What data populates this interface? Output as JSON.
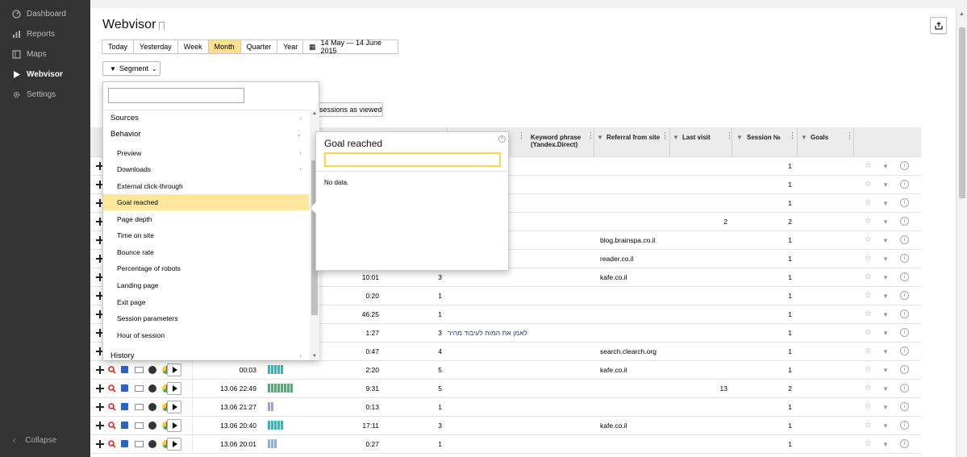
{
  "sidebar": {
    "items": [
      {
        "label": "Dashboard",
        "icon": "dashboard-icon"
      },
      {
        "label": "Reports",
        "icon": "reports-icon"
      },
      {
        "label": "Maps",
        "icon": "maps-icon"
      },
      {
        "label": "Webvisor",
        "icon": "play-icon",
        "active": true
      },
      {
        "label": "Settings",
        "icon": "gear-icon"
      }
    ],
    "collapse_label": "Collapse"
  },
  "header": {
    "title": "Webvisor"
  },
  "periods": [
    "Today",
    "Yesterday",
    "Week",
    "Month",
    "Quarter",
    "Year"
  ],
  "active_period": "Month",
  "date_range": "14 May — 14 June 2015",
  "segment_label": "Segment",
  "viewed_button": "sessions as viewed",
  "table": {
    "headers": {
      "keyword": "Keyword phrase (Yandex.Direct)",
      "referral": "Referral from site",
      "last_visit": "Last visit",
      "session_no": "Session №",
      "goals": "Goals"
    },
    "rows": [
      {
        "time": "",
        "duration": "",
        "depth": "",
        "keyword": "",
        "referral": "",
        "last_visit": "",
        "session": "1"
      },
      {
        "time": "",
        "duration": "",
        "depth": "",
        "keyword": "",
        "referral": "",
        "last_visit": "",
        "session": "1"
      },
      {
        "time": "",
        "duration": "",
        "depth": "",
        "keyword": "",
        "referral": "",
        "last_visit": "",
        "session": "1"
      },
      {
        "time": "",
        "duration": "",
        "depth": "",
        "keyword": "",
        "referral": "",
        "last_visit": "2",
        "session": "2"
      },
      {
        "time": "",
        "duration": "",
        "depth": "",
        "keyword": "",
        "referral": "blog.brainspa.co.il",
        "last_visit": "",
        "session": "1"
      },
      {
        "time": "",
        "duration": "",
        "depth": "",
        "keyword": "",
        "referral": "reader.co.il",
        "last_visit": "",
        "session": "1"
      },
      {
        "time": "",
        "duration": "10:01",
        "depth": "3",
        "keyword": "",
        "referral": "kafe.co.il",
        "last_visit": "",
        "session": "1"
      },
      {
        "time": "",
        "duration": "0:20",
        "depth": "1",
        "keyword": "",
        "referral": "",
        "last_visit": "",
        "session": "1"
      },
      {
        "time": "",
        "duration": "46:25",
        "depth": "1",
        "keyword": "",
        "referral": "",
        "last_visit": "",
        "session": "1"
      },
      {
        "time": "",
        "duration": "1:27",
        "depth": "3",
        "keyword": "לאמן את המוח לעיבוד מהיר",
        "referral": "",
        "last_visit": "",
        "session": "1"
      },
      {
        "time": "",
        "duration": "0:47",
        "depth": "4",
        "keyword": "",
        "referral": "search.clearch.org",
        "last_visit": "",
        "session": "1"
      },
      {
        "time": "00:03",
        "duration": "2:20",
        "depth": "5",
        "keyword": "",
        "referral": "kafe.co.il",
        "last_visit": "",
        "session": "1",
        "bars": "teal5"
      },
      {
        "time": "13.06 22:49",
        "duration": "9:31",
        "depth": "5",
        "keyword": "",
        "referral": "",
        "last_visit": "13",
        "session": "2",
        "bars": "green8"
      },
      {
        "time": "13.06 21:27",
        "duration": "0:13",
        "depth": "1",
        "keyword": "",
        "referral": "",
        "last_visit": "",
        "session": "1",
        "bars": "purple2"
      },
      {
        "time": "13.06 20:40",
        "duration": "17:11",
        "depth": "3",
        "keyword": "",
        "referral": "kafe.co.il",
        "last_visit": "",
        "session": "1",
        "bars": "teal5"
      },
      {
        "time": "13.06 20:01",
        "duration": "0:27",
        "depth": "1",
        "keyword": "",
        "referral": "",
        "last_visit": "",
        "session": "1",
        "bars": "blue3"
      }
    ]
  },
  "segment_menu": {
    "items": [
      {
        "label": "Sources",
        "type": "cat",
        "arrow": "›"
      },
      {
        "label": "Behavior",
        "type": "cat",
        "arrow": "⌄"
      },
      {
        "label": "Preview",
        "type": "sub",
        "arrow": "›"
      },
      {
        "label": "Downloads",
        "type": "sub",
        "arrow": "›"
      },
      {
        "label": "External click-through",
        "type": "sub"
      },
      {
        "label": "Goal reached",
        "type": "sub",
        "selected": true
      },
      {
        "label": "Page depth",
        "type": "sub"
      },
      {
        "label": "Time on site",
        "type": "sub"
      },
      {
        "label": "Bounce rate",
        "type": "sub"
      },
      {
        "label": "Percentage of robots",
        "type": "sub"
      },
      {
        "label": "Landing page",
        "type": "sub"
      },
      {
        "label": "Exit page",
        "type": "sub"
      },
      {
        "label": "Session parameters",
        "type": "sub"
      },
      {
        "label": "Hour of session",
        "type": "sub"
      },
      {
        "label": "History",
        "type": "cat",
        "arrow": "›"
      }
    ]
  },
  "goal_popup": {
    "title": "Goal reached",
    "no_data": "No data."
  },
  "colors": {
    "accent": "#ffe08a",
    "selected": "#ffe89e",
    "sidebar": "#333333"
  }
}
